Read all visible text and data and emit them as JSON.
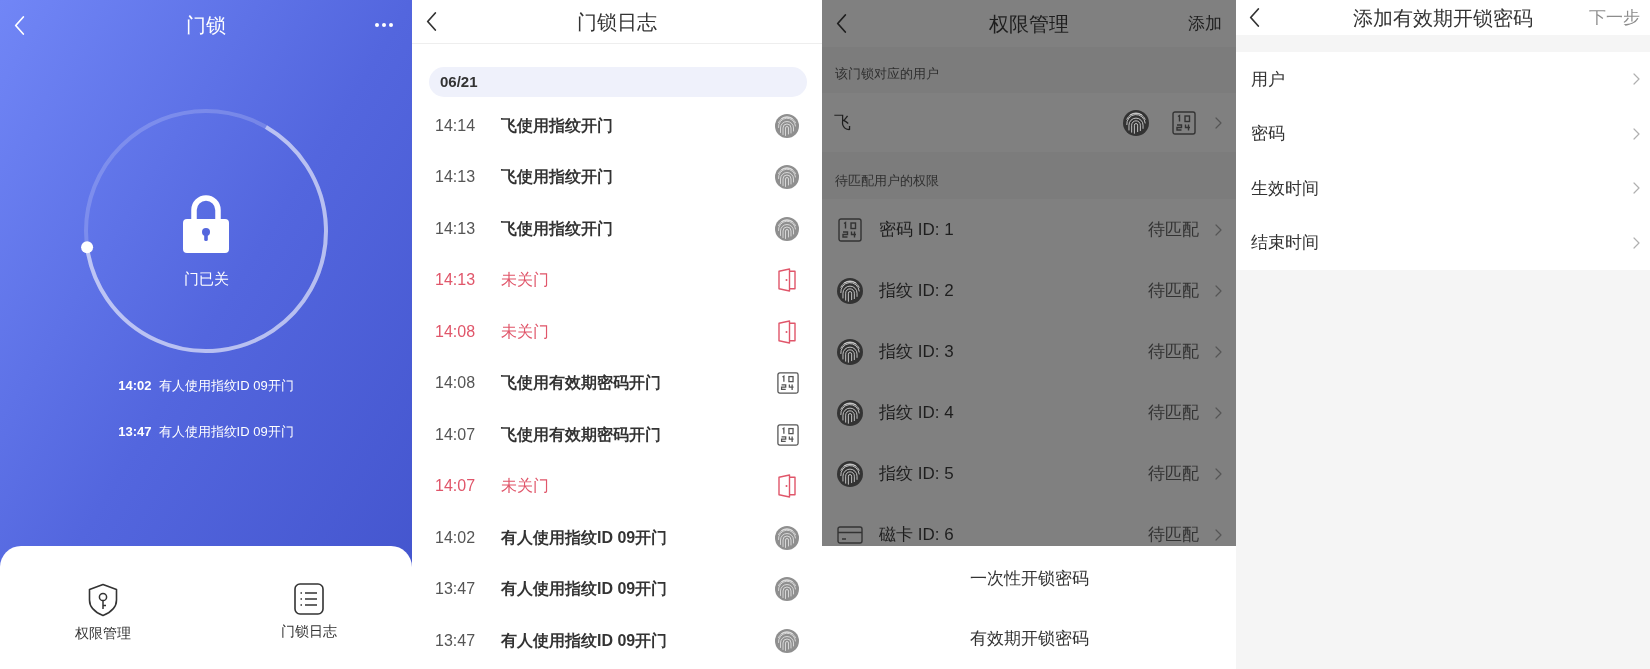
{
  "door_lock": {
    "title": "门锁",
    "status": "门已关",
    "recent_events": [
      {
        "time": "14:02",
        "text": "有人使用指纹ID 09开门"
      },
      {
        "time": "13:47",
        "text": "有人使用指纹ID 09开门"
      }
    ],
    "actions": [
      {
        "kind": "permissions",
        "label": "权限管理"
      },
      {
        "kind": "log",
        "label": "门锁日志"
      }
    ]
  },
  "lock_log": {
    "title": "门锁日志",
    "date": "06/21",
    "entries": [
      {
        "time": "14:14",
        "text": "飞使用指纹开门",
        "kind": "fingerprint",
        "alert": false
      },
      {
        "time": "14:13",
        "text": "飞使用指纹开门",
        "kind": "fingerprint",
        "alert": false
      },
      {
        "time": "14:13",
        "text": "飞使用指纹开门",
        "kind": "fingerprint",
        "alert": false
      },
      {
        "time": "14:13",
        "text": "未关门",
        "kind": "door",
        "alert": true
      },
      {
        "time": "14:08",
        "text": "未关门",
        "kind": "door",
        "alert": true
      },
      {
        "time": "14:08",
        "text": "飞使用有效期密码开门",
        "kind": "password",
        "alert": false
      },
      {
        "time": "14:07",
        "text": "飞使用有效期密码开门",
        "kind": "password",
        "alert": false
      },
      {
        "time": "14:07",
        "text": "未关门",
        "kind": "door",
        "alert": true
      },
      {
        "time": "14:02",
        "text": "有人使用指纹ID 09开门",
        "kind": "fingerprint",
        "alert": false
      },
      {
        "time": "13:47",
        "text": "有人使用指纹ID 09开门",
        "kind": "fingerprint",
        "alert": false
      },
      {
        "time": "13:47",
        "text": "有人使用指纹ID 09开门",
        "kind": "fingerprint",
        "alert": false
      }
    ]
  },
  "permissions": {
    "title": "权限管理",
    "action": "添加",
    "sections": [
      {
        "heading": "该门锁对应的用户",
        "rows": [
          {
            "kind": "user",
            "label": "飞",
            "credentials": [
              {
                "kind": "fingerprint"
              },
              {
                "kind": "password"
              }
            ]
          }
        ]
      },
      {
        "heading": "待匹配用户的权限",
        "rows": [
          {
            "kind": "password",
            "label": "密码 ID: 1",
            "status": "待匹配"
          },
          {
            "kind": "fingerprint",
            "label": "指纹 ID: 2",
            "status": "待匹配"
          },
          {
            "kind": "fingerprint",
            "label": "指纹 ID: 3",
            "status": "待匹配"
          },
          {
            "kind": "fingerprint",
            "label": "指纹 ID: 4",
            "status": "待匹配"
          },
          {
            "kind": "fingerprint",
            "label": "指纹 ID: 5",
            "status": "待匹配"
          },
          {
            "kind": "card",
            "label": "磁卡 ID: 6",
            "status": "待匹配"
          }
        ]
      }
    ],
    "sheet_options": [
      "一次性开锁密码",
      "有效期开锁密码"
    ]
  },
  "add_password": {
    "title": "添加有效期开锁密码",
    "next": {
      "label": "下一步",
      "disabled": true
    },
    "fields": [
      "用户",
      "密码",
      "生效时间",
      "结束时间"
    ]
  }
}
